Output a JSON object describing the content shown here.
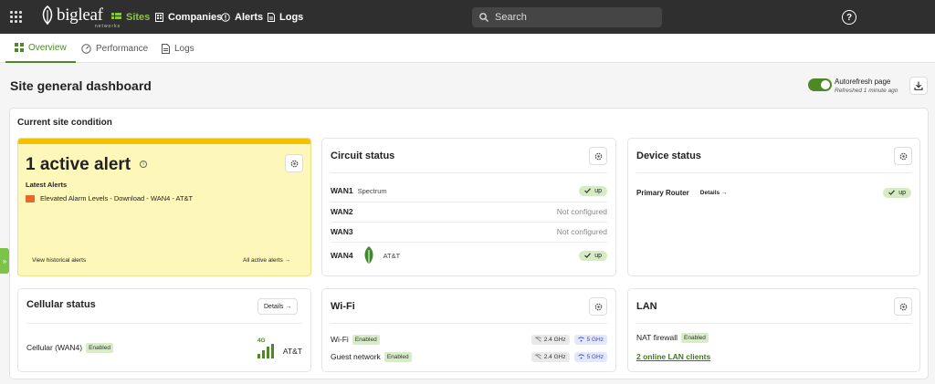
{
  "topbar": {
    "brand": "bigleaf",
    "brand_sub": "networks",
    "nav": {
      "sites": "Sites",
      "companies": "Companies",
      "alerts": "Alerts",
      "logs": "Logs"
    },
    "search_placeholder": "Search",
    "help": "?"
  },
  "tabs": {
    "overview": "Overview",
    "performance": "Performance",
    "logs": "Logs"
  },
  "page": {
    "title": "Site general dashboard",
    "autorefresh_label": "Autorefresh page",
    "refreshed": "Refreshed 1 minute ago",
    "autorefresh_on": true
  },
  "condition": {
    "title": "Current site condition",
    "alert": {
      "count_text": "1 active alert",
      "latest_label": "Latest Alerts",
      "item": "Elevated Alarm Levels - Download - WAN4 - AT&T",
      "historical_link": "View historical alerts",
      "all_link": "All active alerts →"
    },
    "circuit": {
      "title": "Circuit status",
      "rows": [
        {
          "name": "WAN1",
          "provider": "Spectrum",
          "status": "up"
        },
        {
          "name": "WAN2",
          "status_text": "Not configured"
        },
        {
          "name": "WAN3",
          "status_text": "Not configured"
        },
        {
          "name": "WAN4",
          "provider": "AT&T",
          "status": "up"
        }
      ]
    },
    "device": {
      "title": "Device status",
      "router": "Primary Router",
      "details": "Details →",
      "status": "up"
    },
    "cellular": {
      "title": "Cellular status",
      "details": "Details →",
      "label": "Cellular (WAN4)",
      "badge": "Enabled",
      "network": "4G",
      "carrier": "AT&T"
    },
    "wifi": {
      "title": "Wi-Fi",
      "rows": [
        {
          "label": "Wi-Fi",
          "badge": "Enabled",
          "band1": "2.4 GHz",
          "band2": "5 GHz"
        },
        {
          "label": "Guest network",
          "badge": "Enabled",
          "band1": "2.4 GHz",
          "band2": "5 GHz"
        }
      ]
    },
    "lan": {
      "title": "LAN",
      "nat_label": "NAT firewall",
      "nat_badge": "Enabled",
      "clients_link": "2 online LAN clients"
    }
  },
  "side_toggle": "»",
  "colors": {
    "accent": "#4d8a26",
    "alert_bg": "#fdf7b9",
    "alert_stripe": "#f2c200",
    "up_pill": "#d5ebc4"
  }
}
